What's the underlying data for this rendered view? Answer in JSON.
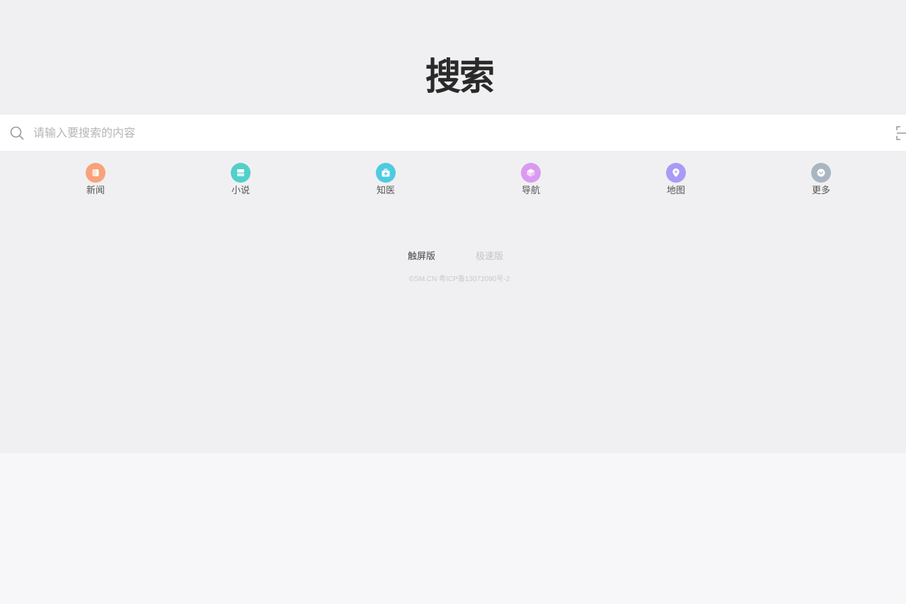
{
  "logo": {
    "text": "搜索"
  },
  "search": {
    "placeholder": "请输入要搜索的内容",
    "value": ""
  },
  "nav": {
    "items": [
      {
        "label": "新闻",
        "icon": "news-icon",
        "color": "#f7a27b"
      },
      {
        "label": "小说",
        "icon": "novel-icon",
        "color": "#53cfc9"
      },
      {
        "label": "知医",
        "icon": "medical-icon",
        "color": "#4fcbe0"
      },
      {
        "label": "导航",
        "icon": "navigation-icon",
        "color": "#d99af0"
      },
      {
        "label": "地图",
        "icon": "map-pin-icon",
        "color": "#a99bf5"
      },
      {
        "label": "更多",
        "icon": "more-icon",
        "color": "#a9b6c2"
      }
    ]
  },
  "mode": {
    "touch": "触屏版",
    "fast": "极速版"
  },
  "footer": {
    "icp": "©SM.CN 粤ICP备13072090号-2"
  }
}
